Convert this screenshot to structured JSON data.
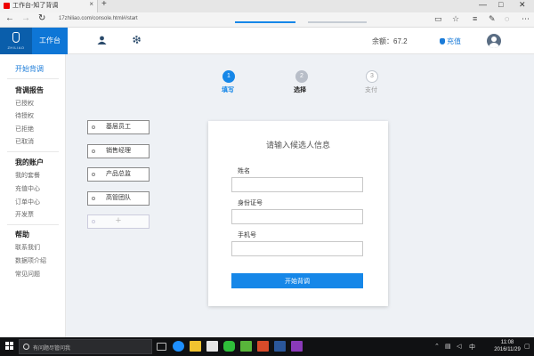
{
  "browser": {
    "tab_title": "工作台-知了背调",
    "tab_close": "×",
    "new_tab": "+",
    "url": "17zhiliao.com/console.html#/start",
    "window_controls": [
      "—",
      "□",
      "✕"
    ],
    "nav": {
      "back": "←",
      "forward": "→",
      "refresh": "↻"
    },
    "toolbar_icons": [
      "reading-view-icon",
      "favorite-icon",
      "hub-icon",
      "note-icon",
      "share-icon",
      "more-icon"
    ]
  },
  "header": {
    "logo_text": "ZHILIAO",
    "workbench_label": "工作台",
    "balance_text": "余额：67.2",
    "recharge_label": "充值",
    "icons": [
      "users-icon",
      "settings-icon",
      "avatar-icon"
    ]
  },
  "sidebar": {
    "start_label": "开始背调",
    "sections": [
      {
        "heading": "背调报告",
        "items": [
          "已授权",
          "待授权",
          "已拒绝",
          "已取消"
        ]
      },
      {
        "heading": "我的账户",
        "items": [
          "我的套餐",
          "充值中心",
          "订单中心",
          "开发票"
        ]
      },
      {
        "heading": "帮助",
        "items": [
          "联系我们",
          "数据项介绍",
          "常见问题"
        ]
      }
    ]
  },
  "steps": [
    {
      "num": "1",
      "label": "填写",
      "state": "active"
    },
    {
      "num": "2",
      "label": "选择",
      "state": "pending"
    },
    {
      "num": "3",
      "label": "支付",
      "state": "pending"
    }
  ],
  "templates": {
    "tags": [
      "基层员工",
      "销售经理",
      "产品总监",
      "高管团队"
    ],
    "add_label": "+"
  },
  "form": {
    "title": "请输入候选人信息",
    "fields": [
      {
        "label": "姓名",
        "value": "",
        "placeholder": ""
      },
      {
        "label": "身份证号",
        "value": "",
        "placeholder": ""
      },
      {
        "label": "手机号",
        "value": "",
        "placeholder": ""
      }
    ],
    "submit_label": "开始背调"
  },
  "taskbar": {
    "search_placeholder": "有问题尽管问我",
    "time": "11:08",
    "date": "2016/11/29",
    "tray_icons": [
      "chevron-up-icon",
      "network-icon",
      "volume-icon",
      "ime-icon",
      "notification-icon"
    ],
    "ime_label": "中",
    "pinned_icons": [
      "task-view-icon",
      "edge-icon",
      "file-explorer-icon",
      "store-icon",
      "wechat-icon",
      "evernote-icon",
      "powerpoint-icon",
      "word-icon",
      "onenote-icon"
    ]
  },
  "colors": {
    "brand_dark": "#0a5eab",
    "brand": "#1687e8",
    "step_active": "#1687e8",
    "step_pending": "#b8bec8",
    "main_bg": "#eef1f5",
    "taskbar_bg": "#101113"
  }
}
